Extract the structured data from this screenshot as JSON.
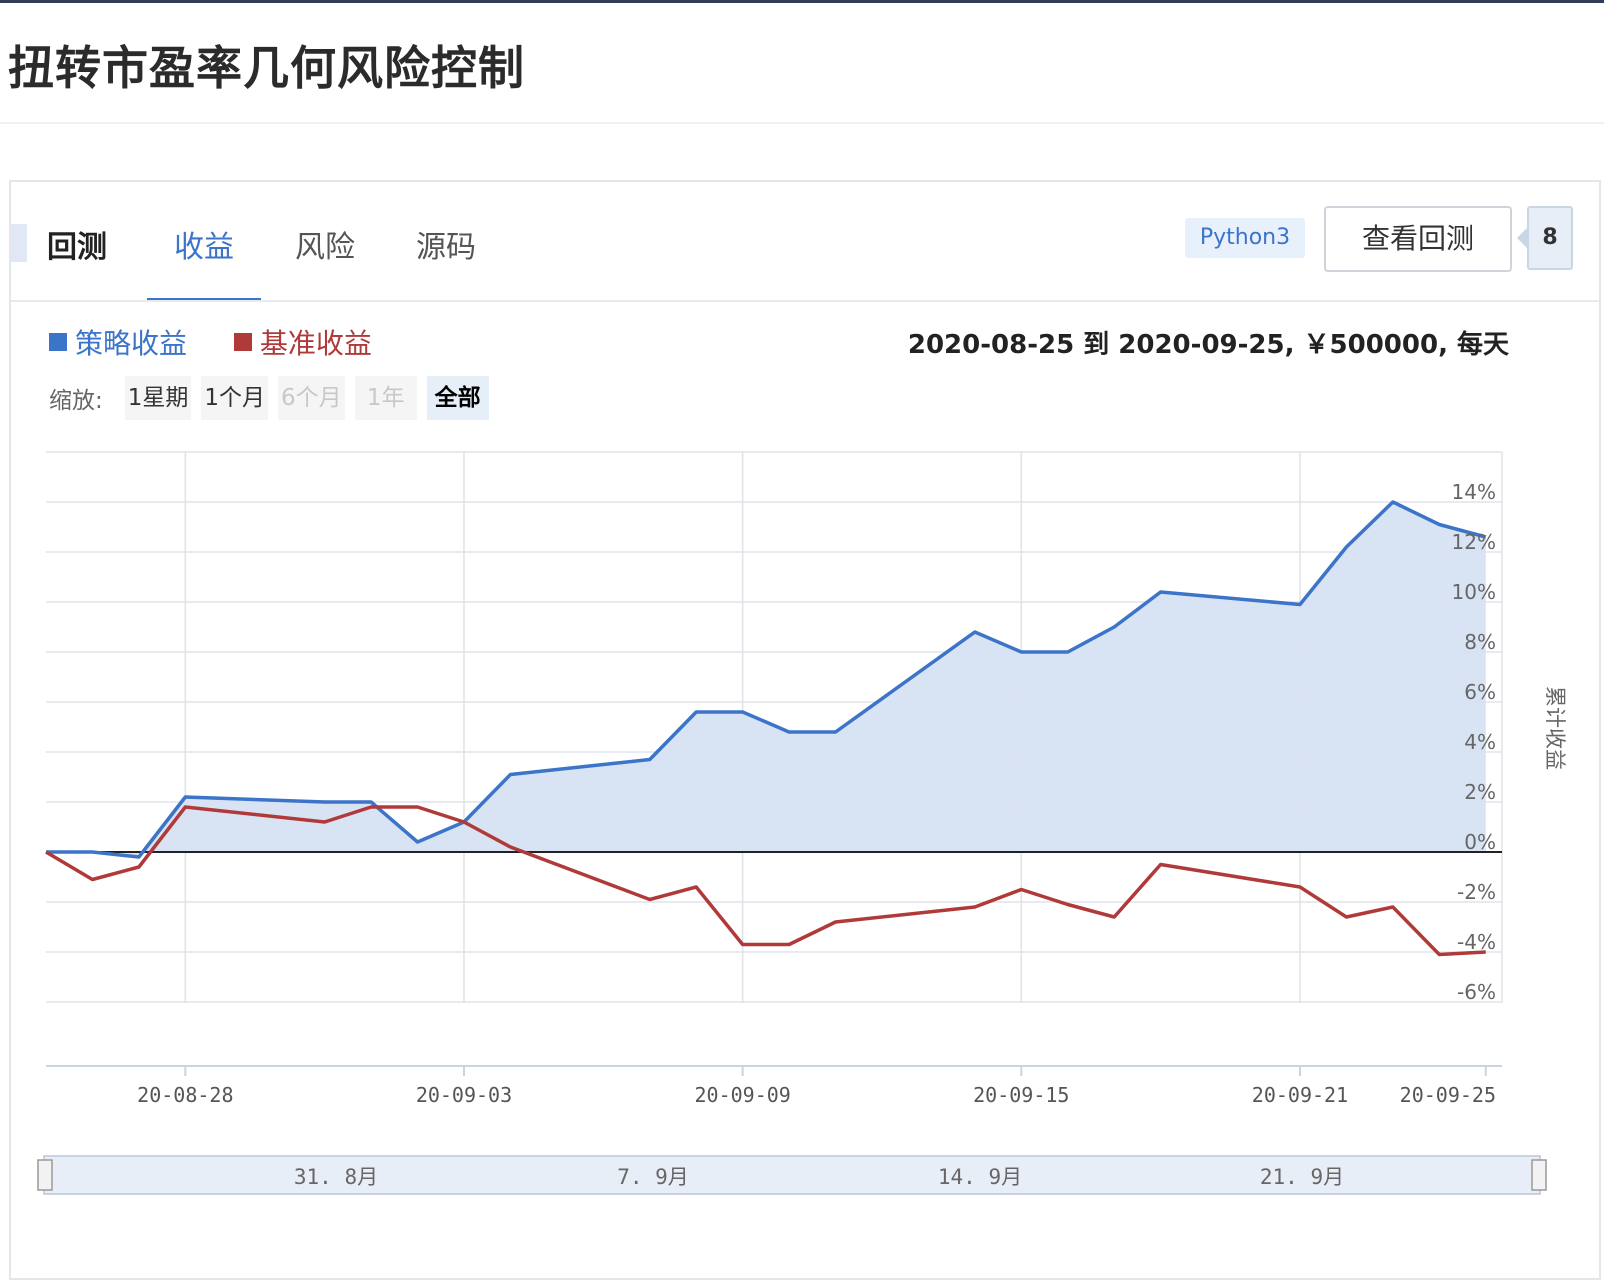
{
  "page": {
    "title": "扭转市盈率几何风险控制"
  },
  "tabs": [
    {
      "label": "回测"
    },
    {
      "label": "收益"
    },
    {
      "label": "风险"
    },
    {
      "label": "源码"
    }
  ],
  "toolbar": {
    "language": "Python3",
    "view_button": "查看回测",
    "count": "8"
  },
  "legend": {
    "strategy": "策略收益",
    "benchmark": "基准收益"
  },
  "period_text": "2020-08-25 到 2020-09-25, ￥500000, 每天",
  "zoom": {
    "label": "缩放:",
    "buttons": [
      {
        "label": "1星期",
        "state": "normal"
      },
      {
        "label": "1个月",
        "state": "normal"
      },
      {
        "label": "6个月",
        "state": "disabled"
      },
      {
        "label": "1年",
        "state": "disabled"
      },
      {
        "label": "全部",
        "state": "selected"
      }
    ]
  },
  "colors": {
    "strategy": "#3b74c8",
    "benchmark": "#b03a3a",
    "area": "#d6e1f3"
  },
  "chart_data": {
    "type": "line",
    "ylabel": "累计收益",
    "ylim": [
      -6,
      14
    ],
    "y_ticks": [
      14,
      12,
      10,
      8,
      6,
      4,
      2,
      0,
      -2,
      -4,
      -6
    ],
    "y_tick_labels": [
      "14%",
      "12%",
      "10%",
      "8%",
      "6%",
      "4%",
      "2%",
      "0%",
      "-2%",
      "-4%",
      "-6%"
    ],
    "x": [
      "2020-08-25",
      "2020-08-26",
      "2020-08-27",
      "2020-08-28",
      "2020-08-31",
      "2020-09-01",
      "2020-09-02",
      "2020-09-03",
      "2020-09-04",
      "2020-09-07",
      "2020-09-08",
      "2020-09-09",
      "2020-09-10",
      "2020-09-11",
      "2020-09-14",
      "2020-09-15",
      "2020-09-16",
      "2020-09-17",
      "2020-09-18",
      "2020-09-21",
      "2020-09-22",
      "2020-09-23",
      "2020-09-24",
      "2020-09-25"
    ],
    "x_tick_labels": [
      {
        "date": "2020-08-28",
        "label": "20-08-28"
      },
      {
        "date": "2020-09-03",
        "label": "20-09-03"
      },
      {
        "date": "2020-09-09",
        "label": "20-09-09"
      },
      {
        "date": "2020-09-15",
        "label": "20-09-15"
      },
      {
        "date": "2020-09-21",
        "label": "20-09-21"
      },
      {
        "date": "2020-09-25",
        "label": "20-09-25"
      }
    ],
    "navigator_labels": [
      "31. 8月",
      "7. 9月",
      "14. 9月",
      "21. 9月"
    ],
    "series": [
      {
        "name": "策略收益",
        "values": [
          0.0,
          0.0,
          -0.2,
          2.2,
          2.0,
          2.0,
          0.4,
          1.2,
          3.1,
          3.7,
          5.6,
          5.6,
          4.8,
          4.8,
          8.8,
          8.0,
          8.0,
          9.0,
          10.4,
          9.9,
          12.2,
          14.0,
          13.1,
          12.6
        ]
      },
      {
        "name": "基准收益",
        "values": [
          0.0,
          -1.1,
          -0.6,
          1.8,
          1.2,
          1.8,
          1.8,
          1.2,
          0.2,
          -1.9,
          -1.4,
          -3.7,
          -3.7,
          -2.8,
          -2.2,
          -1.5,
          -2.1,
          -2.6,
          -0.5,
          -1.4,
          -2.6,
          -2.2,
          -4.1,
          -4.0
        ]
      }
    ]
  }
}
